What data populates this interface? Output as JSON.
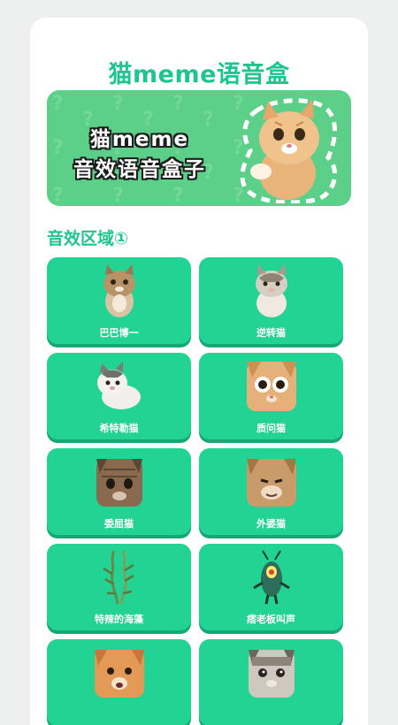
{
  "app": {
    "title": "猫meme语音盒"
  },
  "banner": {
    "line1": "猫meme",
    "line2": "音效语音盒子"
  },
  "section": {
    "title": "音效区域①"
  },
  "sounds": [
    {
      "label": "巴巴博一",
      "icon": "tabby-cat-icon"
    },
    {
      "label": "逆转猫",
      "icon": "grey-white-cat-icon"
    },
    {
      "label": "希特勒猫",
      "icon": "white-grey-cat-icon"
    },
    {
      "label": "质问猫",
      "icon": "orange-shocked-cat-icon"
    },
    {
      "label": "委屈猫",
      "icon": "sad-tabby-cat-icon"
    },
    {
      "label": "外婆猫",
      "icon": "old-tabby-cat-icon"
    },
    {
      "label": "特辣的海藻",
      "icon": "seaweed-icon"
    },
    {
      "label": "痞老板叫声",
      "icon": "plankton-icon"
    },
    {
      "label": "",
      "icon": "orange-cat-icon"
    },
    {
      "label": "",
      "icon": "crying-cat-icon"
    }
  ],
  "colors": {
    "accent": "#1ec58e",
    "tile": "#22d393",
    "tile_shadow": "#15a874",
    "banner": "#5ccf88"
  }
}
